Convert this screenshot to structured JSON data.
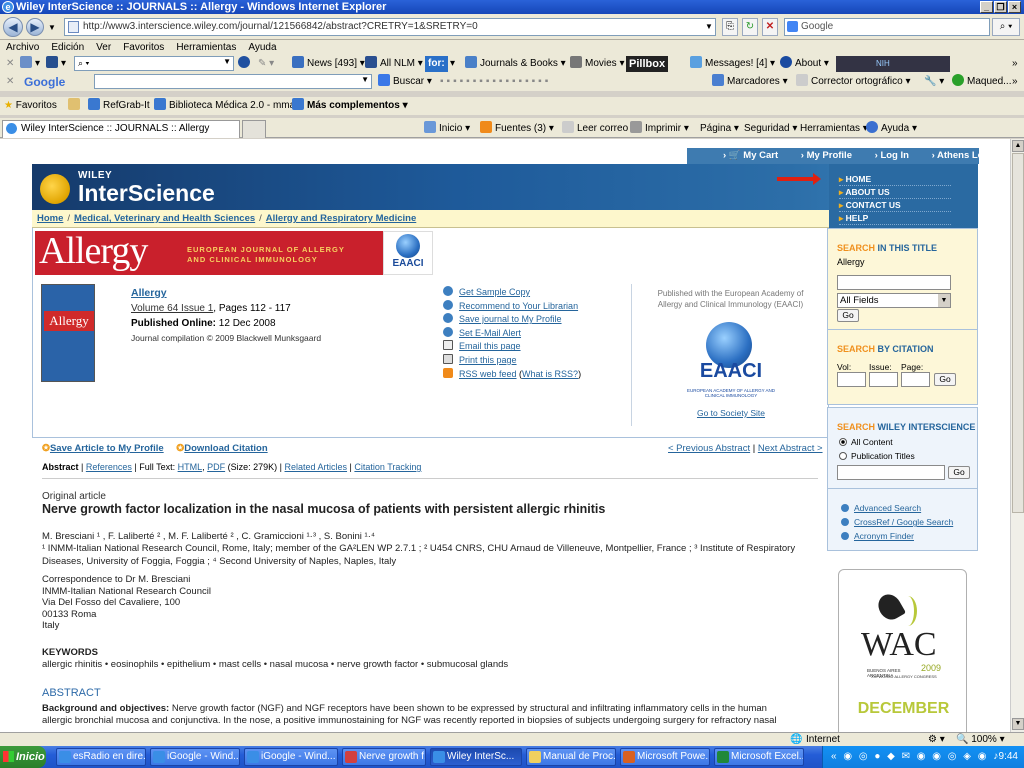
{
  "window": {
    "title": "Wiley InterScience :: JOURNALS :: Allergy - Windows Internet Explorer"
  },
  "address": {
    "url": "http://www3.interscience.wiley.com/journal/121566842/abstract?CRETRY=1&SRETRY=0",
    "search_placeholder": "Google"
  },
  "menu": [
    "Archivo",
    "Edición",
    "Ver",
    "Favoritos",
    "Herramientas",
    "Ayuda"
  ],
  "toolbar1": {
    "news": "News [493]",
    "allnlm": "All NLM",
    "forlabel": "for:",
    "journals": "Journals & Books",
    "movies": "Movies",
    "pillbox": "Pillbox",
    "messages": "Messages! [4]",
    "about": "About",
    "nih": "NIH"
  },
  "toolbar2": {
    "google": "Google",
    "buscar": "Buscar",
    "marcadores": "Marcadores",
    "corrector": "Corrector ortográfico",
    "maqued": "Maqued..."
  },
  "favbar": {
    "favoritos": "Favoritos",
    "refgrab": "RefGrab-It",
    "biblioteca": "Biblioteca Médica 2.0 - mma...",
    "mas": "Más complementos"
  },
  "tab": {
    "title": "Wiley InterScience :: JOURNALS :: Allergy"
  },
  "commandbar": {
    "inicio": "Inicio",
    "fuentes": "Fuentes (3)",
    "leer": "Leer correo",
    "imprimir": "Imprimir",
    "pagina": "Página",
    "seguridad": "Seguridad",
    "herramientas": "Herramientas",
    "ayuda": "Ayuda"
  },
  "page": {
    "topnav": [
      "My Cart",
      "My Profile",
      "Log In",
      "Athens Log In"
    ],
    "brand_small": "WILEY",
    "brand": "InterScience",
    "rightmenu": [
      "HOME",
      "ABOUT US",
      "CONTACT US",
      "HELP"
    ],
    "breadcrumb": [
      "Home",
      "Medical, Veterinary and Health Sciences",
      "Allergy and Respiratory Medicine"
    ],
    "journal_banner": {
      "title": "Allergy",
      "subtitle_line1": "EUROPEAN JOURNAL OF ALLERGY",
      "subtitle_line2": "AND CLINICAL IMMUNOLOGY",
      "badge": "EAACI"
    },
    "cover_title": "Allergy",
    "journal": {
      "name": "Allergy",
      "volume": "Volume 64 Issue 1",
      "pages": ", Pages 112 - 117",
      "published_label": "Published Online:",
      "published_date": "12 Dec 2008",
      "compilation": "Journal compilation © 2009 Blackwell Munksgaard"
    },
    "actions": [
      "Get Sample Copy",
      "Recommend to Your Librarian",
      "Save journal to My Profile",
      "Set E-Mail Alert",
      "Email this page",
      "Print this page",
      "RSS web feed"
    ],
    "rss_what": "What is RSS?",
    "society": {
      "text": "Published with the European Academy of Allergy and Clinical Immunology (EAACI)",
      "logo": "EAACI",
      "logo_sub": "EUROPEAN ACADEMY OF ALLERGY AND CLINICAL IMMUNOLOGY",
      "link": "Go to Society Site"
    },
    "save_article": "Save Article to My Profile",
    "download_citation": "Download Citation",
    "prev_abstract": "< Previous Abstract",
    "next_abstract": "Next Abstract >",
    "subnav": {
      "abstract": "Abstract",
      "references": "References",
      "fulltext": "Full Text:",
      "html": "HTML",
      "pdf": "PDF",
      "size": "(Size: 279K)",
      "related": "Related Articles",
      "tracking": "Citation Tracking"
    },
    "article": {
      "kind": "Original article",
      "title": "Nerve growth factor localization in the nasal mucosa of patients with persistent allergic rhinitis",
      "authors": "M. Bresciani ¹ , F. Laliberté ² , M. F. Laliberté ² , C. Gramiccioni ¹·³ , S. Bonini ¹·⁴",
      "affil1": "¹ INMM-Italian National Research Council, Rome, Italy; member of the GA²LEN WP 2.7.1 ; ² U454 CNRS, CHU Arnaud de Villeneuve, Montpellier, France ; ³ Institute of Respiratory",
      "affil2": "Diseases, University of Foggia, Foggia ; ⁴ Second University of Naples, Naples, Italy",
      "corr": [
        "Correspondence to Dr M. Bresciani",
        "INMM-Italian National Research Council",
        "Via Del Fosso del Cavaliere, 100",
        "00133 Roma",
        "Italy"
      ],
      "keywords_h": "KEYWORDS",
      "keywords": "allergic rhinitis • eosinophils • epithelium • mast cells • nasal mucosa • nerve growth factor • submucosal glands",
      "abstract_h": "ABSTRACT",
      "bg_label": "Background and objectives:",
      "bg_text": " Nerve growth factor (NGF) and NGF receptors have been shown to be expressed by structural and infiltrating inflammatory cells in the human",
      "bg_text2": "allergic bronchial mucosa and conjunctiva. In the nose, a positive immunostaining for NGF was recently reported in biopsies of subjects undergoing surgery for refractory nasal"
    },
    "search_title": {
      "h1": "SEARCH",
      "h2": "IN THIS TITLE",
      "title": "Allergy",
      "select": "All Fields",
      "go": "Go"
    },
    "search_citation": {
      "h1": "SEARCH",
      "h2": "BY CITATION",
      "vol": "Vol:",
      "issue": "Issue:",
      "page": "Page:",
      "go": "Go"
    },
    "search_wiley": {
      "h1": "SEARCH",
      "h2": "WILEY INTERSCIENCE",
      "opt1": "All Content",
      "opt2": "Publication Titles",
      "go": "Go",
      "links": [
        "Advanced Search",
        "CrossRef / Google Search",
        "Acronym Finder"
      ]
    },
    "ad": {
      "logo": "WAC",
      "sub": "BUENOS AIRES ARGENTINA",
      "year": "2009",
      "congress": "XXI WORLD ALLERGY CONGRESS",
      "month": "DECEMBER"
    }
  },
  "status": {
    "zone": "Internet",
    "zoom": "100%"
  },
  "taskbar": {
    "start": "Inicio",
    "tasks": [
      "esRadio en dire...",
      "iGoogle - Wind...",
      "iGoogle - Wind...",
      "Nerve growth f...",
      "Wiley InterSc...",
      "Manual de Proc...",
      "Microsoft Powe...",
      "Microsoft Excel..."
    ],
    "clock": "9:44"
  }
}
